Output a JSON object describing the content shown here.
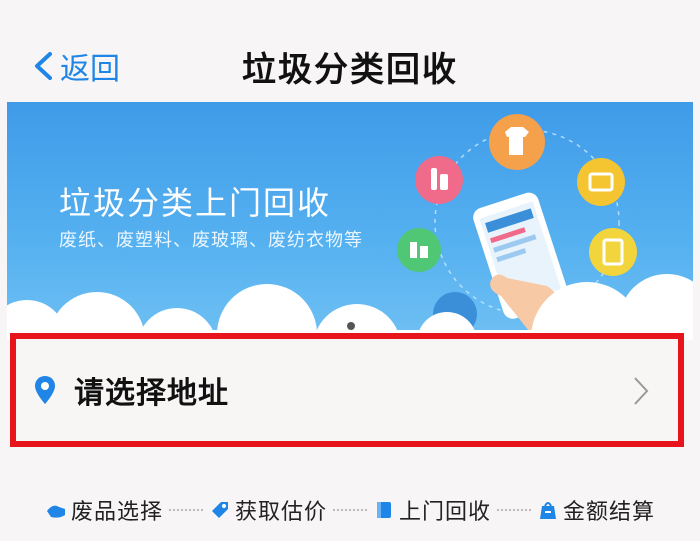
{
  "navbar": {
    "back_label": "返回",
    "title": "垃圾分类回收"
  },
  "banner": {
    "title": "垃圾分类上门回收",
    "subtitle": "废纸、废塑料、废玻璃、废纺衣物等"
  },
  "address": {
    "label": "请选择地址"
  },
  "steps": [
    {
      "label": "废品选择",
      "icon": "hand-icon"
    },
    {
      "label": "获取估价",
      "icon": "tag-icon"
    },
    {
      "label": "上门回收",
      "icon": "box-icon"
    },
    {
      "label": "金额结算",
      "icon": "bag-icon"
    }
  ],
  "colors": {
    "accent": "#1f86e8",
    "highlight": "#e8141b",
    "banner": "#4aa6ee"
  }
}
